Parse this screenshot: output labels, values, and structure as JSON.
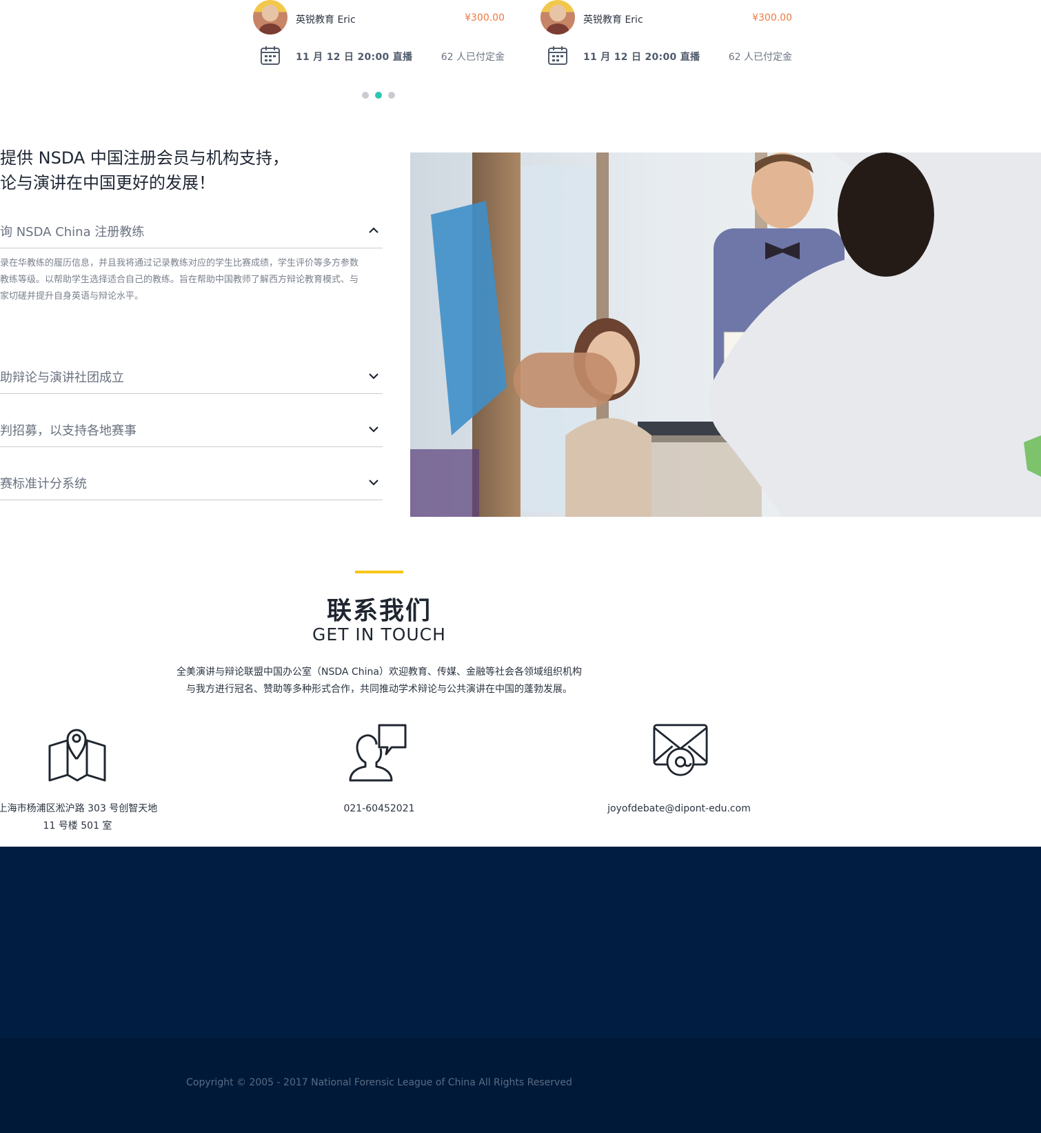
{
  "courses": [
    {
      "author": "英锐教育 Eric",
      "price": "¥300.00",
      "schedule": "11 月 12 日  20:00 直播",
      "paid": "62 人已付定金"
    },
    {
      "author": "英锐教育 Eric",
      "price": "¥300.00",
      "schedule": "11 月 12 日  20:00 直播",
      "paid": "62 人已付定金"
    }
  ],
  "carousel": {
    "count": 3,
    "active_index": 1
  },
  "support": {
    "headline_line1": "提供 NSDA 中国注册会员与机构支持，",
    "headline_line2": "论与演讲在中国更好的发展！",
    "accordion": [
      {
        "label": "询 NSDA China 注册教练",
        "expanded": true,
        "desc_lines": [
          "录在华教练的履历信息，并且我将通过记录教练对应的学生比赛成绩，学生评价等多方参数",
          "教练等级。以帮助学生选择适合自己的教练。旨在帮助中国教师了解西方辩论教育模式、与",
          "家切磋并提升自身英语与辩论水平。"
        ]
      },
      {
        "label": "助辩论与演讲社团成立",
        "expanded": false
      },
      {
        "label": "判招募，以支持各地赛事",
        "expanded": false
      },
      {
        "label": "赛标准计分系统",
        "expanded": false
      }
    ]
  },
  "contact": {
    "title_cn": "联系我们",
    "title_en": "GET IN TOUCH",
    "intro_line1": "全美演讲与辩论联盟中国办公室（NSDA China）欢迎教育、传媒、金融等社会各领域组织机构",
    "intro_line2": "与我方进行冠名、赞助等多种形式合作，共同推动学术辩论与公共演讲在中国的蓬勃发展。",
    "address_line1": "上海市杨浦区淞沪路 303 号创智天地",
    "address_line2": "11 号楼 501 室",
    "phone": "021-60452021",
    "email": "joyofdebate@dipont-edu.com"
  },
  "footer": {
    "copyright": "Copyright © 2005 - 2017 National Forensic League of China All Rights Reserved"
  },
  "colors": {
    "accent_teal": "#2dc7b0",
    "price_orange": "#f0793f",
    "title_bar_yellow": "#f5c518",
    "footer_navy": "#011e42",
    "footer_bottom": "#001939"
  }
}
